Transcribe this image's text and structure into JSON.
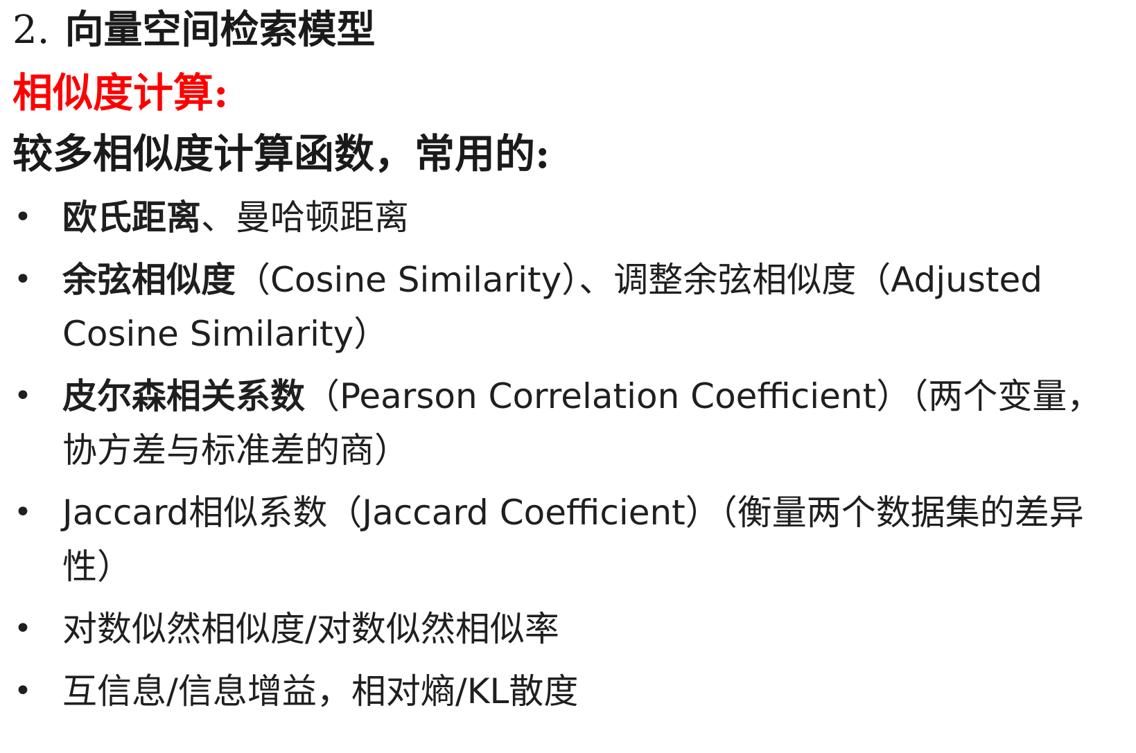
{
  "slide": {
    "heading_number": "2.",
    "heading_text": "向量空间检索模型",
    "subheading": "相似度计算:",
    "intro": "较多相似度计算函数，常用的:",
    "bullet_glyph": "•",
    "accent_color": "#ff0000",
    "bullets": [
      {
        "strong": "欧氏距离",
        "rest": "、曼哈顿距离"
      },
      {
        "strong": "余弦相似度",
        "rest": "（Cosine Similarity）、调整余弦相似度（Adjusted Cosine Similarity）"
      },
      {
        "strong": "皮尔森相关系数",
        "rest": "（Pearson Correlation Coefficient）（两个变量，协方差与标准差的商）"
      },
      {
        "strong": "",
        "rest": "Jaccard相似系数（Jaccard Coefficient）（衡量两个数据集的差异性）"
      },
      {
        "strong": "",
        "rest": "对数似然相似度/对数似然相似率"
      },
      {
        "strong": "",
        "rest": "互信息/信息增益，相对熵/KL散度"
      }
    ]
  }
}
